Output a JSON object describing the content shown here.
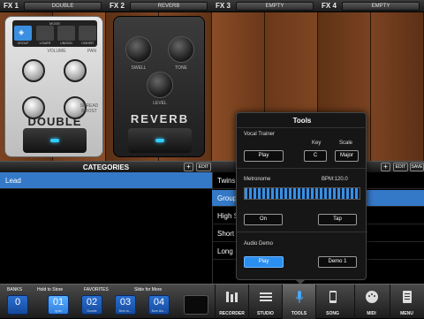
{
  "fx_slots": [
    {
      "label": "FX 1",
      "name": "DOUBLE"
    },
    {
      "label": "FX 2",
      "name": "REVERB"
    },
    {
      "label": "FX 3",
      "name": "EMPTY"
    },
    {
      "label": "FX 4",
      "name": "EMPTY"
    }
  ],
  "double_pedal": {
    "mode_label": "MODE",
    "modes": [
      "GROUP",
      "LOWER",
      "UNISON",
      "HIGHER"
    ],
    "knob_labels": [
      "VOLUME",
      "PAN",
      "",
      ""
    ],
    "knob_side_labels": [
      "WIDTH",
      "SPREAD"
    ],
    "knob_side_label_b": "BOOST",
    "name": "DOUBLE"
  },
  "reverb_pedal": {
    "knob_labels": [
      "SWELL",
      "TONE",
      "LEVEL"
    ],
    "name": "REVERB"
  },
  "categories": {
    "title": "CATEGORIES",
    "add_icon": "+",
    "edit_label": "EDIT",
    "right_add_icon": "+",
    "right_edit_label": "EDIT",
    "right_save_label": "SAVE",
    "items": [
      "Lead",
      "Twins",
      "Group",
      "High S",
      "Short",
      "Long"
    ]
  },
  "tools_popup": {
    "title": "Tools",
    "vocal_trainer": "Vocal Trainer",
    "key_label": "Key",
    "scale_label": "Scale",
    "play_label": "Play",
    "key_value": "C",
    "scale_value": "Major",
    "metronome": "Metronome",
    "bpm": "BPM:120.0",
    "on_label": "On",
    "tap_label": "Tap",
    "audio_demo": "Audio Demo",
    "demo_play": "Play",
    "demo_select": "Demo 1"
  },
  "bottom": {
    "banks_label": "BANKS",
    "bank_value": "0",
    "hold_label": "Hold to Store",
    "favorites_label": "FAVORITES",
    "slide_label": "Slide for More",
    "favorites": [
      {
        "num": "01",
        "sub": "Ignite"
      },
      {
        "num": "02",
        "sub": "Double"
      },
      {
        "num": "03",
        "sub": "Born to…"
      },
      {
        "num": "04",
        "sub": "Born Alo…"
      }
    ],
    "tabs": [
      "RECORDER",
      "STUDIO",
      "TOOLS",
      "SONG",
      "MIDI",
      "MENU"
    ]
  },
  "colors": {
    "accent": "#3a8fe0",
    "selected_row": "#3479c7",
    "wood": "#6b3a1c"
  }
}
